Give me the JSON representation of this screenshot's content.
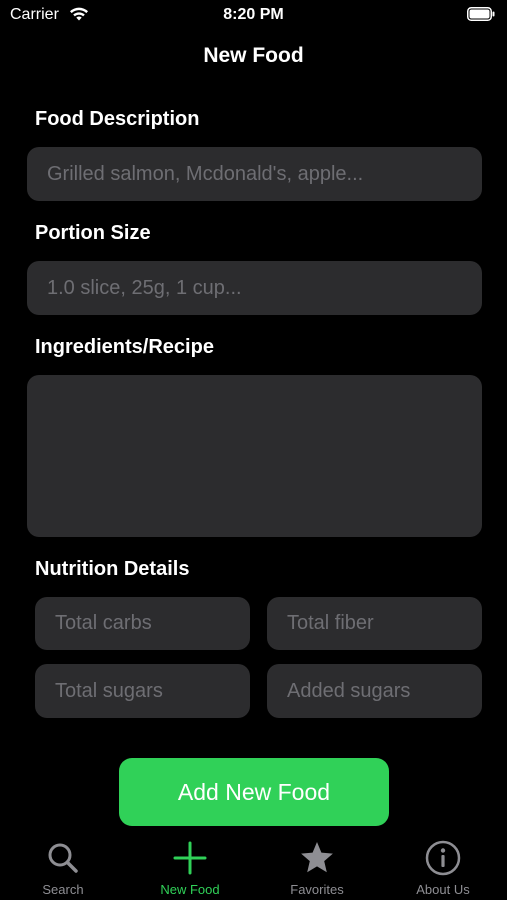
{
  "status_bar": {
    "carrier": "Carrier",
    "time": "8:20 PM"
  },
  "nav": {
    "title": "New Food"
  },
  "form": {
    "description_label": "Food Description",
    "description_placeholder": "Grilled salmon, Mcdonald's, apple...",
    "portion_label": "Portion Size",
    "portion_placeholder": "1.0 slice, 25g, 1 cup...",
    "ingredients_label": "Ingredients/Recipe",
    "ingredients_value": "",
    "nutrition_label": "Nutrition Details",
    "nutrition_fields": {
      "total_carbs": "Total carbs",
      "total_fiber": "Total fiber",
      "total_sugars": "Total sugars",
      "added_sugars": "Added sugars"
    }
  },
  "submit_button": "Add New Food",
  "tabs": [
    {
      "label": "Search",
      "icon": "search-icon",
      "active": false
    },
    {
      "label": "New Food",
      "icon": "plus-icon",
      "active": true
    },
    {
      "label": "Favorites",
      "icon": "star-icon",
      "active": false
    },
    {
      "label": "About Us",
      "icon": "info-icon",
      "active": false
    }
  ],
  "colors": {
    "background": "#000000",
    "field_background": "#2c2c2e",
    "accent_green": "#30d158",
    "inactive_tab": "#8e8e93",
    "placeholder": "#6e6e73"
  }
}
